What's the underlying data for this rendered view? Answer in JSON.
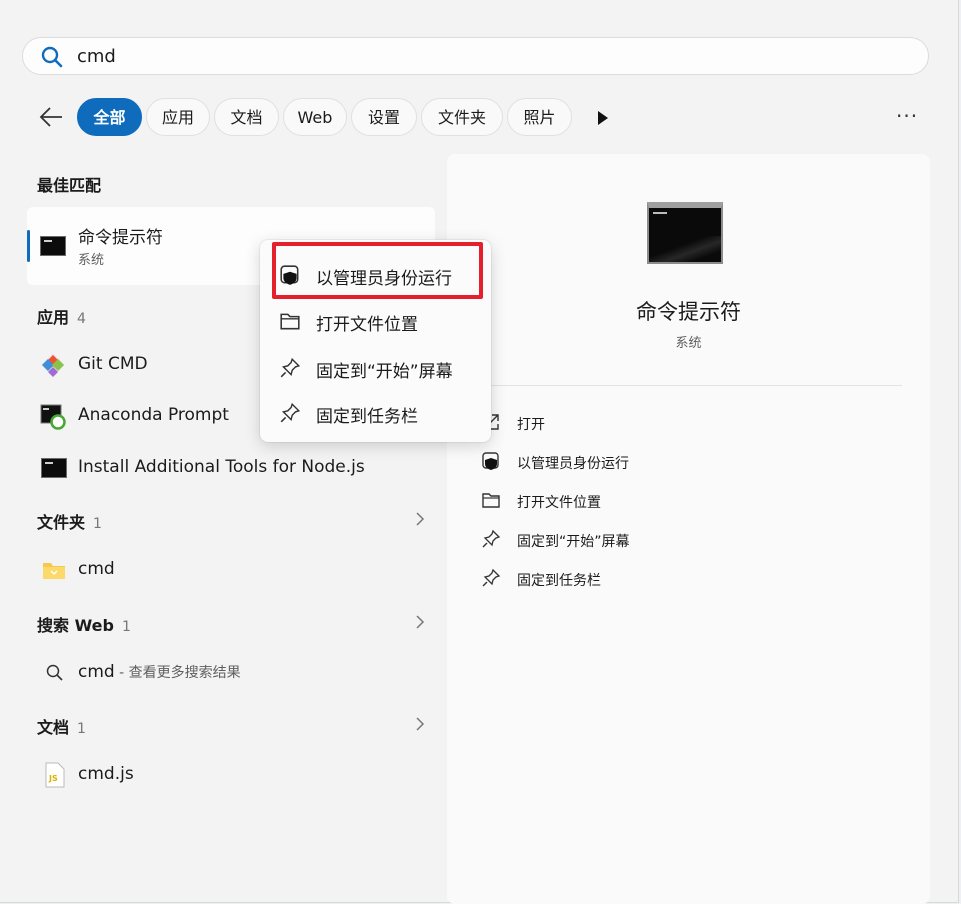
{
  "search": {
    "value": "cmd"
  },
  "filters": [
    "全部",
    "应用",
    "文档",
    "Web",
    "设置",
    "文件夹",
    "照片"
  ],
  "best_match": {
    "heading": "最佳匹配",
    "title": "命令提示符",
    "subtitle": "系统"
  },
  "apps": {
    "heading": "应用",
    "count": "4",
    "items": [
      "Git CMD",
      "Anaconda Prompt",
      "Install Additional Tools for Node.js"
    ]
  },
  "folders": {
    "heading": "文件夹",
    "count": "1",
    "items": [
      "cmd"
    ]
  },
  "web": {
    "heading": "搜索 Web",
    "count": "1",
    "item": "cmd",
    "item_desc": " - 查看更多搜索结果"
  },
  "docs": {
    "heading": "文档",
    "count": "1",
    "items": [
      "cmd.js"
    ]
  },
  "context_menu": [
    "以管理员身份运行",
    "打开文件位置",
    "固定到“开始”屏幕",
    "固定到任务栏"
  ],
  "details": {
    "title": "命令提示符",
    "subtitle": "系统",
    "actions": [
      "打开",
      "以管理员身份运行",
      "打开文件位置",
      "固定到“开始”屏幕",
      "固定到任务栏"
    ]
  },
  "colors": {
    "accent": "#0f6cbd",
    "highlight": "#e3202c"
  }
}
